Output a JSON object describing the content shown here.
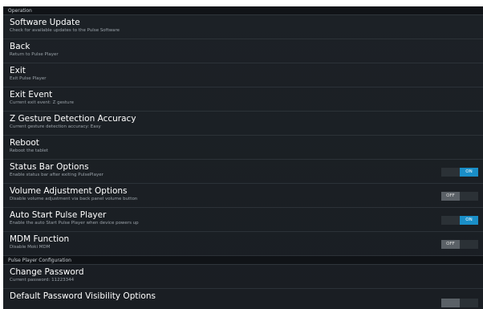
{
  "sections": {
    "operation": "Operation",
    "config": "Pulse Player Configuration"
  },
  "rows": [
    {
      "title": "Software Update",
      "subtitle": "Check for available updates to the Pulse Software"
    },
    {
      "title": "Back",
      "subtitle": "Return to Pulse Player"
    },
    {
      "title": "Exit",
      "subtitle": "Exit Pulse Player"
    },
    {
      "title": "Exit Event",
      "subtitle": "Current exit event: Z gesture"
    },
    {
      "title": "Z Gesture Detection Accuracy",
      "subtitle": "Current gesture detection accuracy: Easy"
    },
    {
      "title": "Reboot",
      "subtitle": "Reboot the tablet"
    },
    {
      "title": "Status Bar Options",
      "subtitle": "Enable status bar after exiting PulsePlayer",
      "toggle": "ON"
    },
    {
      "title": "Volume Adjustment Options",
      "subtitle": "Disable volume adjustment via back panel volume button",
      "toggle": "OFF"
    },
    {
      "title": "Auto Start Pulse Player",
      "subtitle": "Enable the auto Start Pulse Player when device powers up",
      "toggle": "ON"
    },
    {
      "title": "MDM Function",
      "subtitle": "Disable Moki MDM",
      "toggle": "OFF"
    },
    {
      "title": "Change Password",
      "subtitle": "Current password: 11223344"
    },
    {
      "title": "Default Password Visibility Options"
    }
  ],
  "colors": {
    "accent_on": "#1a8ec7",
    "toggle_off": "#5b6167",
    "background": "#1c2126"
  }
}
